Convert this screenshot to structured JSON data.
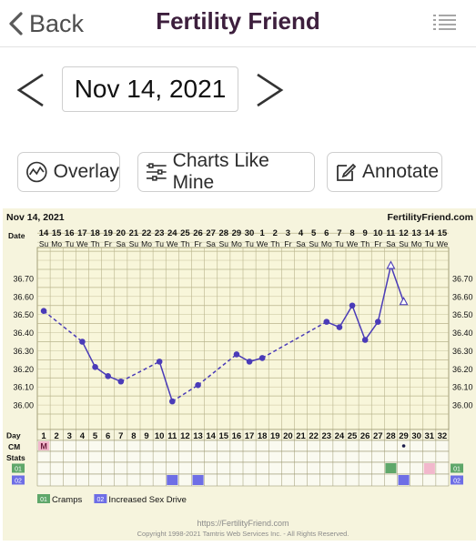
{
  "header": {
    "back_label": "Back",
    "title": "Fertility Friend"
  },
  "date_nav": {
    "current_date": "Nov 14, 2021"
  },
  "toolbar": {
    "overlay_label": "Overlay",
    "charts_like_mine_label": "Charts Like Mine",
    "annotate_label": "Annotate"
  },
  "chart": {
    "date_label": "Nov 14, 2021",
    "brand": "FertilityFriend.com",
    "date_row_label": "Date",
    "day_row_label": "Day",
    "cm_label": "CM",
    "stats_label": "Stats",
    "dates": [
      "14",
      "15",
      "16",
      "17",
      "18",
      "19",
      "20",
      "21",
      "22",
      "23",
      "24",
      "25",
      "26",
      "27",
      "28",
      "29",
      "30",
      "1",
      "2",
      "3",
      "4",
      "5",
      "6",
      "7",
      "8",
      "9",
      "10",
      "11",
      "12",
      "13",
      "14",
      "15"
    ],
    "weekdays": [
      "Su",
      "Mo",
      "Tu",
      "We",
      "Th",
      "Fr",
      "Sa",
      "Su",
      "Mo",
      "Tu",
      "We",
      "Th",
      "Fr",
      "Sa",
      "Su",
      "Mo",
      "Tu",
      "We",
      "Th",
      "Fr",
      "Sa",
      "Su",
      "Mo",
      "Tu",
      "We",
      "Th",
      "Fr",
      "Sa",
      "Su",
      "Mo",
      "Tu",
      "We"
    ],
    "cycle_days": [
      "1",
      "2",
      "3",
      "4",
      "5",
      "6",
      "7",
      "8",
      "9",
      "10",
      "11",
      "12",
      "13",
      "14",
      "15",
      "16",
      "17",
      "18",
      "19",
      "20",
      "21",
      "22",
      "23",
      "24",
      "25",
      "26",
      "27",
      "28",
      "29",
      "30",
      "31",
      "32"
    ],
    "y_ticks": [
      "36.70",
      "36.60",
      "36.50",
      "36.40",
      "36.30",
      "36.20",
      "36.10",
      "36.00"
    ],
    "cm_entries": [
      {
        "day": 1,
        "text": "M",
        "color": "#f2b8cc"
      }
    ],
    "cm_dot_day": 29,
    "cm_pink_day": 31,
    "stats_rows": [
      {
        "code": "01",
        "color": "#5fa76a"
      },
      {
        "code": "02",
        "color": "#6e6ee6"
      }
    ],
    "legend": [
      {
        "code": "01",
        "label": "Cramps",
        "color": "#5fa76a"
      },
      {
        "code": "02",
        "label": "Increased Sex Drive",
        "color": "#6e6ee6"
      }
    ],
    "footer_url": "https://FertilityFriend.com",
    "copyright": "Copyright 1998-2021 Tamtris Web Services Inc. - All Rights Reserved."
  },
  "chart_data": {
    "type": "line",
    "ylim": [
      35.93,
      36.77
    ],
    "x": [
      1,
      4,
      5,
      6,
      7,
      10,
      11,
      13,
      16,
      17,
      18,
      23,
      24,
      25,
      26,
      27,
      28,
      29
    ],
    "y": [
      36.52,
      36.35,
      36.21,
      36.16,
      36.13,
      36.24,
      36.02,
      36.11,
      36.28,
      36.24,
      36.26,
      36.46,
      36.43,
      36.55,
      36.36,
      36.46,
      36.77,
      36.57
    ],
    "point_style": [
      "dot",
      "dot",
      "dot",
      "dot",
      "dot",
      "dot",
      "dot",
      "dot",
      "dot",
      "dot",
      "dot",
      "dot",
      "dot",
      "dot",
      "dot",
      "dot",
      "open-triangle",
      "open-triangle"
    ],
    "segments": [
      "dashed",
      "solid",
      "solid",
      "solid",
      "dashed",
      "solid",
      "dashed",
      "dashed",
      "solid",
      "solid",
      "dashed",
      "solid",
      "solid",
      "solid",
      "solid",
      "solid",
      "solid"
    ],
    "stats": [
      {
        "row": "01",
        "days": [
          28
        ]
      },
      {
        "row": "02",
        "days": [
          11,
          13,
          29
        ]
      }
    ],
    "line_color": "#4a3bb8",
    "grid": true
  }
}
